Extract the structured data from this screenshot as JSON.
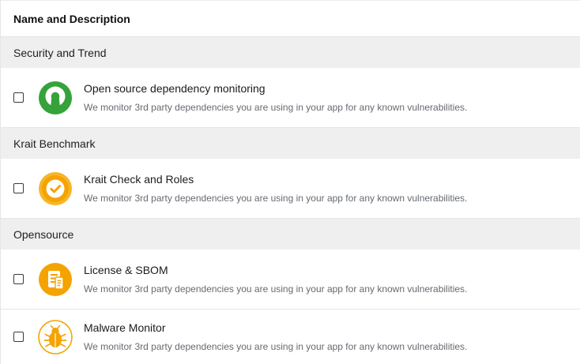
{
  "header": {
    "column_label": "Name and Description"
  },
  "groups": [
    {
      "label": "Security and Trend",
      "items": [
        {
          "title": "Open source dependency monitoring",
          "description": "We monitor 3rd party dependencies you are using in your app for any known vulnerabilities.",
          "icon": "open-source-icon",
          "checked": false
        }
      ]
    },
    {
      "label": "Krait Benchmark",
      "items": [
        {
          "title": "Krait Check and Roles",
          "description": "We monitor 3rd party dependencies you are using in your app for any known vulnerabilities.",
          "icon": "check-badge-icon",
          "checked": false
        }
      ]
    },
    {
      "label": "Opensource",
      "items": [
        {
          "title": "License & SBOM",
          "description": "We monitor 3rd party dependencies you are using in your app for any known vulnerabilities.",
          "icon": "license-document-icon",
          "checked": false
        },
        {
          "title": "Malware Monitor",
          "description": "We monitor 3rd party dependencies you are using in your app for any known vulnerabilities.",
          "icon": "bug-icon",
          "checked": false
        }
      ]
    }
  ],
  "colors": {
    "open_source_green": "#35a33a",
    "amber": "#f5a300",
    "amber_light": "#f7b52a"
  }
}
